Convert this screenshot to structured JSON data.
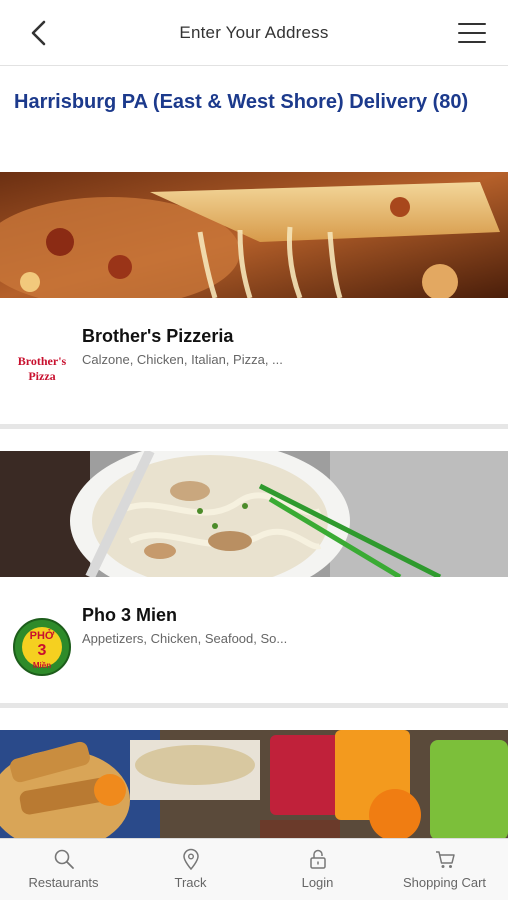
{
  "header": {
    "title": "Enter Your Address",
    "back_icon": "chevron-left-icon",
    "menu_icon": "hamburger-menu-icon"
  },
  "page": {
    "heading": "Harrisburg PA (East & West Shore) Delivery (80)"
  },
  "restaurants": [
    {
      "name": "Brother's Pizzeria",
      "categories": "Calzone, Chicken, Italian, Pizza, ...",
      "logo_line1": "Brother's",
      "logo_line2": "Pizza"
    },
    {
      "name": "Pho 3 Mien",
      "categories": "Appetizers, Chicken, Seafood, So...",
      "logo_line1": "PHỞ",
      "logo_line2": "3",
      "logo_line3": "Miền"
    }
  ],
  "tabbar": {
    "items": [
      {
        "label": "Restaurants",
        "icon": "search-icon"
      },
      {
        "label": "Track",
        "icon": "location-pin-icon"
      },
      {
        "label": "Login",
        "icon": "lock-icon"
      },
      {
        "label": "Shopping Cart",
        "icon": "cart-icon"
      }
    ]
  },
  "colors": {
    "heading": "#1c3a8c",
    "logo_red": "#c8102e"
  }
}
